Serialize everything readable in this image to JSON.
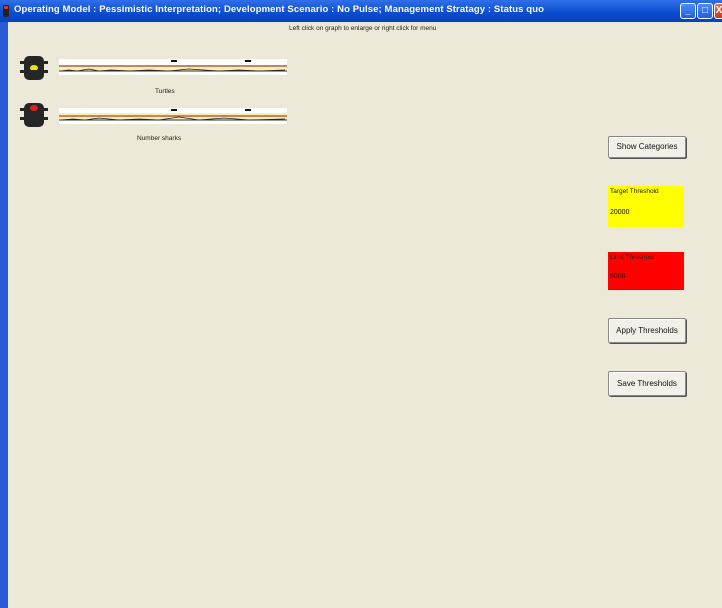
{
  "window": {
    "title": "Operating Model :  Pessimistic Interpretation;  Development Scenario :  No Pulse;  Management Stratagy :  Status quo",
    "minimize_glyph": "_",
    "maximize_glyph": "□",
    "close_glyph": "X"
  },
  "hint": "Left click on graph to enlarge or right click for menu",
  "indicators": [
    {
      "label": "Turtles",
      "light": "yellow"
    },
    {
      "label": "Number sharks",
      "light": "red"
    }
  ],
  "buttons": {
    "show_categories": "Show Categories",
    "apply_thresholds": "Apply Thresholds",
    "save_thresholds": "Save Thresholds"
  },
  "target_threshold": {
    "label": "Target Threshold",
    "value": "20000"
  },
  "limit_threshold": {
    "label": "Limit Threshold",
    "value": "5000"
  },
  "colors": {
    "title_bar": "#0a4bd0",
    "window_bg": "#ece9d8",
    "target": "#ffff00",
    "limit": "#ff0000",
    "light_yellow": "#f2e50c",
    "light_red": "#e02020"
  }
}
